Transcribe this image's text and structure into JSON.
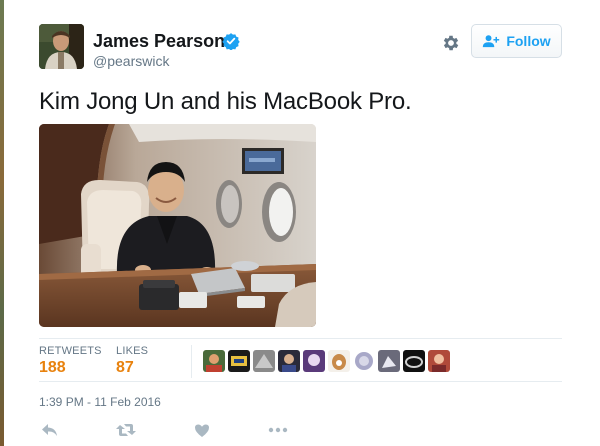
{
  "tweet": {
    "author_name": "James Pearson",
    "author_handle": "@pearswick",
    "text": "Kim Jong Un and his MacBook Pro.",
    "timestamp": "1:39 PM - 11 Feb 2016"
  },
  "header": {
    "follow_label": "Follow"
  },
  "stats": {
    "retweets_label": "RETWEETS",
    "retweets_count": "188",
    "likes_label": "LIKES",
    "likes_count": "87"
  },
  "icons": {
    "verified": "verified-badge-icon",
    "settings": "gear-icon",
    "follow": "add-user-icon",
    "reply": "reply-icon",
    "retweet": "retweet-icon",
    "like": "heart-icon",
    "more": "more-dots-icon"
  },
  "colors": {
    "accent": "#1da1f2",
    "stat_value": "#e8820e",
    "muted": "#657786",
    "action_icon": "#aab8c2"
  }
}
